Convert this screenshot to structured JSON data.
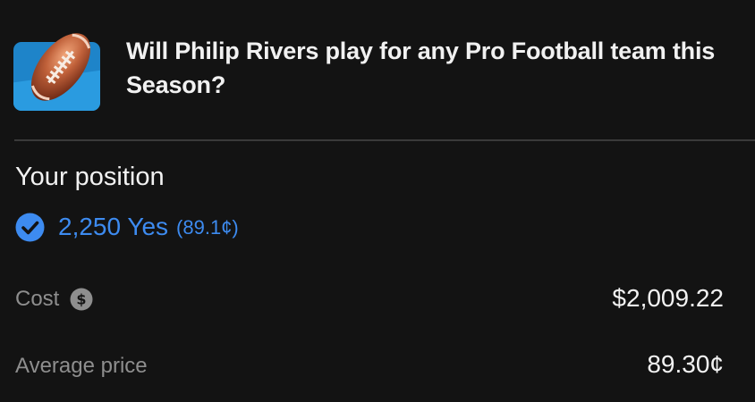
{
  "market": {
    "title": "Will Philip Rivers play for any Pro Football team this Season?",
    "thumbnail_icon": "football-icon"
  },
  "position": {
    "heading": "Your position",
    "shares_text": "2,250 Yes",
    "avg_price_text": "(89.1¢)",
    "status_icon": "check-circle-icon"
  },
  "stats": {
    "cost_label": "Cost",
    "cost_icon": "dollar-circle-icon",
    "cost_value": "$2,009.22",
    "average_price_label": "Average price",
    "average_price_value": "89.30¢"
  },
  "colors": {
    "background": "#131313",
    "accent_blue": "#3d8bf0",
    "muted_text": "#8e8e8e",
    "primary_text": "#f2f2f2",
    "thumbnail_blue": "#1e84c9"
  }
}
